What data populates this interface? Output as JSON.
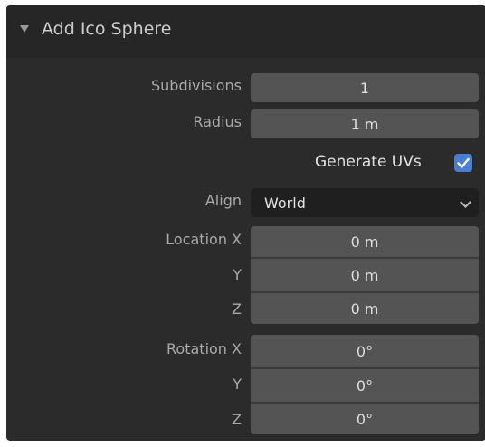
{
  "panel": {
    "title": "Add Ico Sphere"
  },
  "fields": {
    "subdivisions": {
      "label": "Subdivisions",
      "value": "1"
    },
    "radius": {
      "label": "Radius",
      "value": "1 m"
    },
    "generate_uvs": {
      "label": "Generate UVs",
      "checked": true
    },
    "align": {
      "label": "Align",
      "value": "World"
    },
    "location": {
      "x_label": "Location X",
      "x_value": "0 m",
      "y_label": "Y",
      "y_value": "0 m",
      "z_label": "Z",
      "z_value": "0 m"
    },
    "rotation": {
      "x_label": "Rotation X",
      "x_value": "0°",
      "y_label": "Y",
      "y_value": "0°",
      "z_label": "Z",
      "z_value": "0°"
    }
  },
  "icons": {
    "collapse": "triangle-down-icon",
    "dropdown": "chevron-down-icon",
    "check": "checkmark-icon"
  },
  "colors": {
    "panel_bg": "#2b2b2b",
    "header_bg": "#262626",
    "field_bg": "#545454",
    "dropdown_bg": "#1f1f1f",
    "checkbox_bg": "#4a7ed4"
  }
}
